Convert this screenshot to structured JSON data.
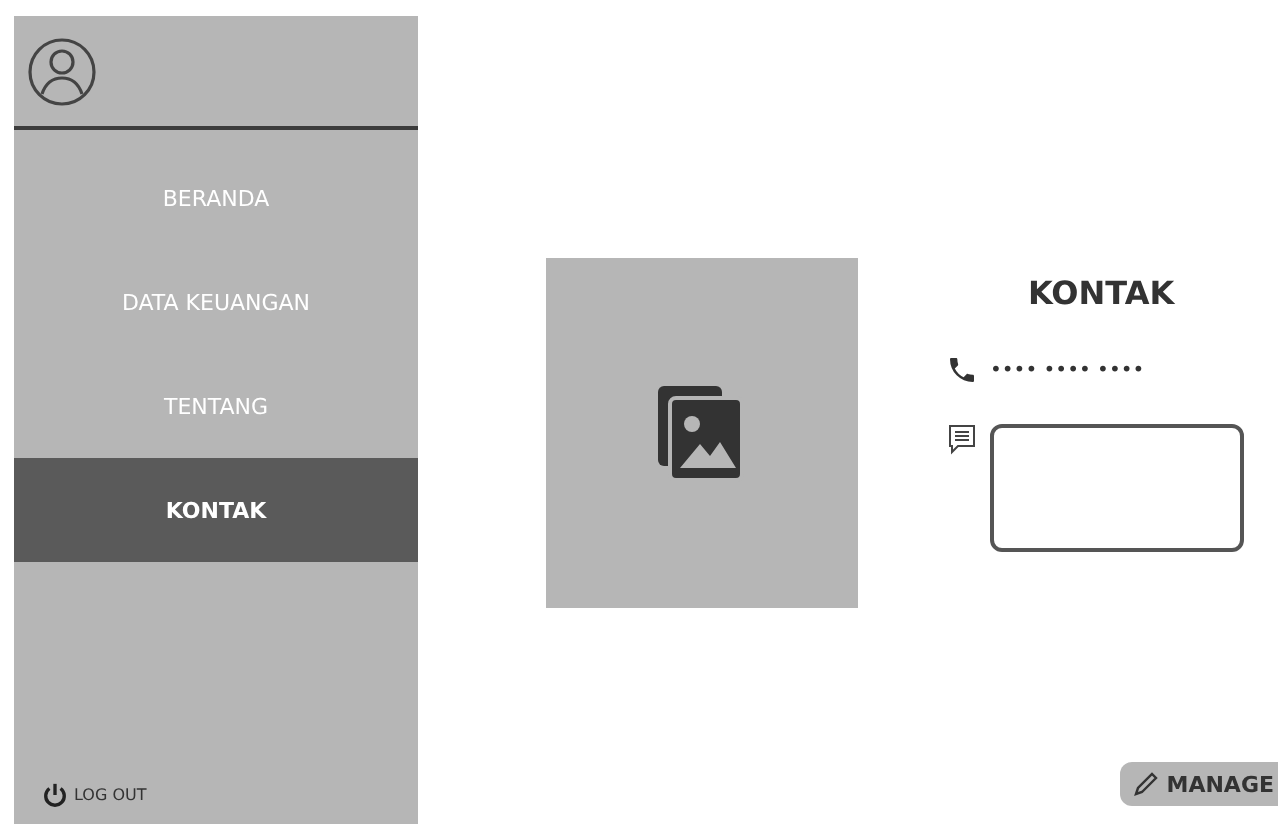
{
  "sidebar": {
    "items": [
      {
        "label": "BERANDA",
        "selected": false
      },
      {
        "label": "DATA KEUANGAN",
        "selected": false
      },
      {
        "label": "TENTANG",
        "selected": false
      },
      {
        "label": "KONTAK",
        "selected": true
      }
    ],
    "logout": "LOG OUT"
  },
  "contact": {
    "title": "KONTAK",
    "phone": "•••• •••• ••••"
  },
  "manage_button": "MANAGE"
}
